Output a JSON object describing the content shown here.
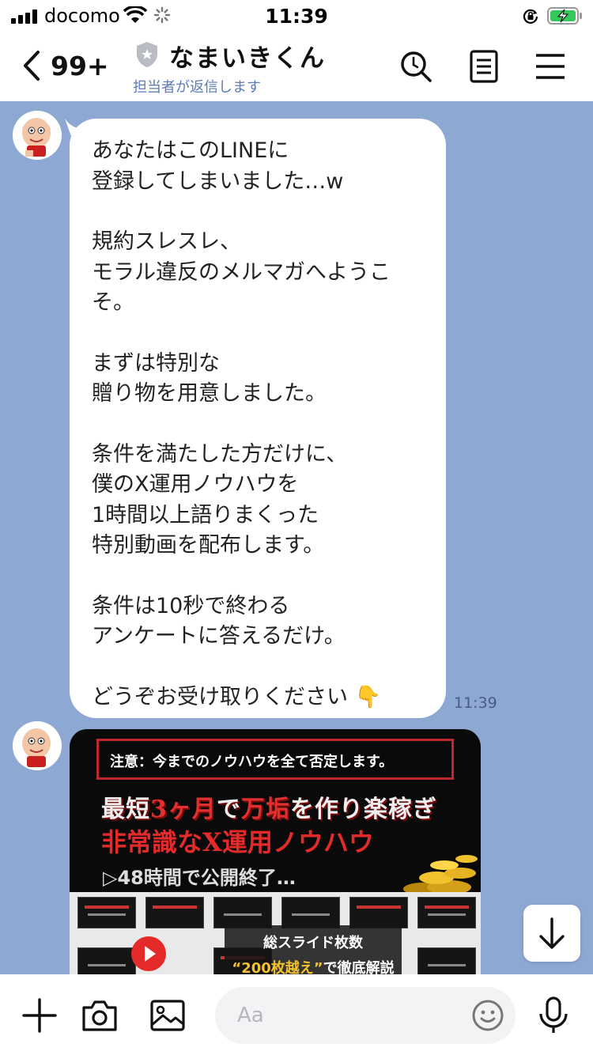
{
  "status_bar": {
    "carrier": "docomo",
    "time": "11:39"
  },
  "header": {
    "back_count": "99+",
    "chat_name": "なまいきくん",
    "subtitle": "担当者が返信します"
  },
  "messages": [
    {
      "type": "text",
      "paragraphs": [
        "あなたはこのLINEに\n登録してしまいました…w",
        "規約スレスレ、\nモラル違反のメルマガへようこ\nそ。",
        "まずは特別な\n贈り物を用意しました。",
        "条件を満たした方だけに、\n僕のX運用ノウハウを\n1時間以上語りまくった\n特別動画を配布します。",
        "条件は10秒で終わる\nアンケートに答えるだけ。",
        "どうぞお受け取りください 👇"
      ],
      "time": "11:39"
    },
    {
      "type": "image",
      "warning": "注意：今までのノウハウを全て否定します。",
      "headline_parts": [
        "最短",
        "3ヶ月",
        "で",
        "万垢",
        "を作り楽稼ぎ"
      ],
      "headline2": "非常識なX運用ノウハウ",
      "note": "▷48時間で公開終了…",
      "overlay_line1": "総スライド枚数",
      "overlay_quote": "“200枚越え”",
      "overlay_rest": "で徹底解説"
    }
  ],
  "input": {
    "placeholder": "Aa"
  },
  "icons": {
    "header": [
      "back-icon",
      "shield-icon",
      "search-icon",
      "notes-icon",
      "menu-icon"
    ],
    "input": [
      "plus-icon",
      "camera-icon",
      "image-icon",
      "emoji-icon",
      "mic-icon"
    ],
    "float": "arrow-down-icon"
  },
  "colors": {
    "chat_background": "#8ea8d4",
    "subtitle": "#5c7bb8",
    "accent_red": "#e52a2a"
  }
}
